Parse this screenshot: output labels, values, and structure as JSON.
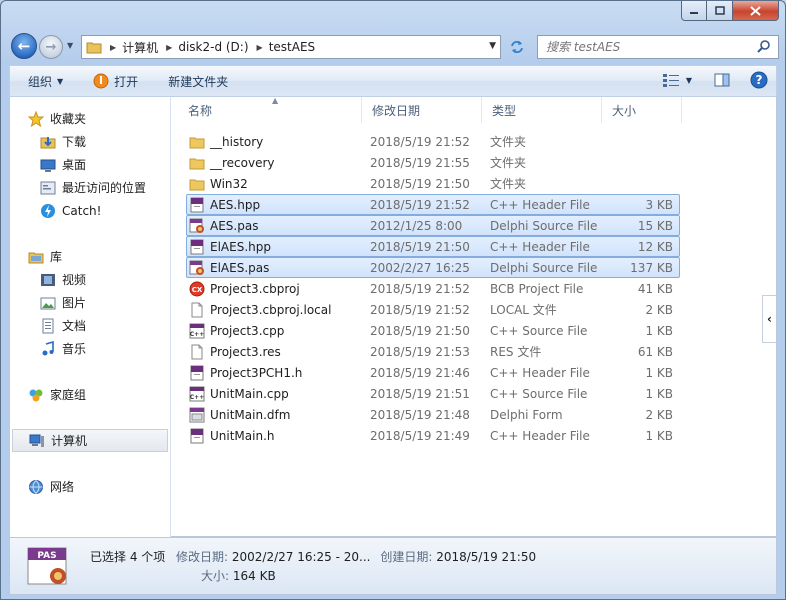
{
  "address": {
    "segments": [
      "计算机",
      "disk2-d (D:)",
      "testAES"
    ]
  },
  "search": {
    "placeholder": "搜索 testAES"
  },
  "toolbar": {
    "organize_label": "组织",
    "open_label": "打开",
    "new_folder_label": "新建文件夹"
  },
  "nav": {
    "favorites": {
      "label": "收藏夹",
      "items": [
        "下载",
        "桌面",
        "最近访问的位置",
        "Catch!"
      ]
    },
    "libraries": {
      "label": "库",
      "items": [
        "视频",
        "图片",
        "文档",
        "音乐"
      ]
    },
    "homegroup": "家庭组",
    "computer": "计算机",
    "network": "网络"
  },
  "columns": {
    "name": "名称",
    "date": "修改日期",
    "type": "类型",
    "size": "大小"
  },
  "files": [
    {
      "name": "__history",
      "date": "2018/5/19 21:52",
      "type": "文件夹",
      "size": "",
      "icon": "folder-icon",
      "selected": false
    },
    {
      "name": "__recovery",
      "date": "2018/5/19 21:55",
      "type": "文件夹",
      "size": "",
      "icon": "folder-icon",
      "selected": false
    },
    {
      "name": "Win32",
      "date": "2018/5/19 21:50",
      "type": "文件夹",
      "size": "",
      "icon": "folder-icon",
      "selected": false
    },
    {
      "name": "AES.hpp",
      "date": "2018/5/19 21:52",
      "type": "C++ Header File",
      "size": "3 KB",
      "icon": "header-file-icon",
      "selected": true
    },
    {
      "name": "AES.pas",
      "date": "2012/1/25 8:00",
      "type": "Delphi Source File",
      "size": "15 KB",
      "icon": "delphi-file-icon",
      "selected": true
    },
    {
      "name": "ElAES.hpp",
      "date": "2018/5/19 21:50",
      "type": "C++ Header File",
      "size": "12 KB",
      "icon": "header-file-icon",
      "selected": true
    },
    {
      "name": "ElAES.pas",
      "date": "2002/2/27 16:25",
      "type": "Delphi Source File",
      "size": "137 KB",
      "icon": "delphi-file-icon",
      "selected": true
    },
    {
      "name": "Project3.cbproj",
      "date": "2018/5/19 21:52",
      "type": "BCB Project File",
      "size": "41 KB",
      "icon": "cbproj-file-icon",
      "selected": false
    },
    {
      "name": "Project3.cbproj.local",
      "date": "2018/5/19 21:52",
      "type": "LOCAL 文件",
      "size": "2 KB",
      "icon": "blank-file-icon",
      "selected": false
    },
    {
      "name": "Project3.cpp",
      "date": "2018/5/19 21:50",
      "type": "C++ Source File",
      "size": "1 KB",
      "icon": "cpp-file-icon",
      "selected": false
    },
    {
      "name": "Project3.res",
      "date": "2018/5/19 21:53",
      "type": "RES 文件",
      "size": "61 KB",
      "icon": "blank-file-icon",
      "selected": false
    },
    {
      "name": "Project3PCH1.h",
      "date": "2018/5/19 21:46",
      "type": "C++ Header File",
      "size": "1 KB",
      "icon": "header-file-icon",
      "selected": false
    },
    {
      "name": "UnitMain.cpp",
      "date": "2018/5/19 21:51",
      "type": "C++ Source File",
      "size": "1 KB",
      "icon": "cpp-file-icon",
      "selected": false
    },
    {
      "name": "UnitMain.dfm",
      "date": "2018/5/19 21:48",
      "type": "Delphi Form",
      "size": "2 KB",
      "icon": "dfm-file-icon",
      "selected": false
    },
    {
      "name": "UnitMain.h",
      "date": "2018/5/19 21:49",
      "type": "C++ Header File",
      "size": "1 KB",
      "icon": "header-file-icon",
      "selected": false
    }
  ],
  "details": {
    "title": "已选择 4 个项",
    "modified_key": "修改日期:",
    "modified_value": "2002/2/27 16:25 - 20...",
    "created_key": "创建日期:",
    "created_value": "2018/5/19 21:50",
    "size_key": "大小:",
    "size_value": "164 KB",
    "thumb_text": "PAS"
  }
}
